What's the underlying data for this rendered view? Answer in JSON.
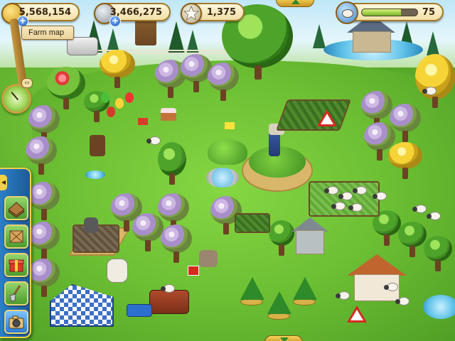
{
  "hud": {
    "coins": "5,568,154",
    "gears": "3,466,275",
    "stars": "1,375",
    "level": "75",
    "level_progress": 0.7,
    "plus_label": "+",
    "accent": "#2a7fc7"
  },
  "nav": {
    "farm_map_label": "Farm map",
    "clock_arrows": "‹›",
    "collapse_label": "◀"
  },
  "toolbar": {
    "items": [
      {
        "icon": "field-plot-icon"
      },
      {
        "icon": "crate-icon"
      },
      {
        "icon": "gift-box-icon"
      },
      {
        "icon": "shovel-icon"
      },
      {
        "icon": "camera-icon"
      }
    ]
  }
}
